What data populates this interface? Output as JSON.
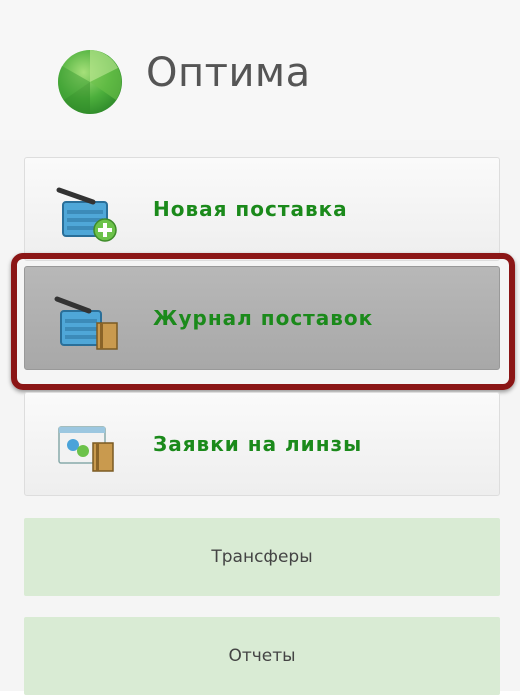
{
  "app": {
    "title": "Оптима"
  },
  "menu": {
    "items": [
      {
        "label": "Новая поставка",
        "icon": "basket-add-icon"
      },
      {
        "label": "Журнал поставок",
        "icon": "basket-journal-icon",
        "selected": true
      },
      {
        "label": "Заявки на линзы",
        "icon": "lens-orders-icon"
      }
    ],
    "secondary": [
      {
        "label": "Трансферы"
      },
      {
        "label": "Отчеты"
      }
    ]
  },
  "colors": {
    "accent_green": "#1b8a1b",
    "highlight_ring": "#8b1616",
    "secondary_bg": "#d9ebd4"
  }
}
